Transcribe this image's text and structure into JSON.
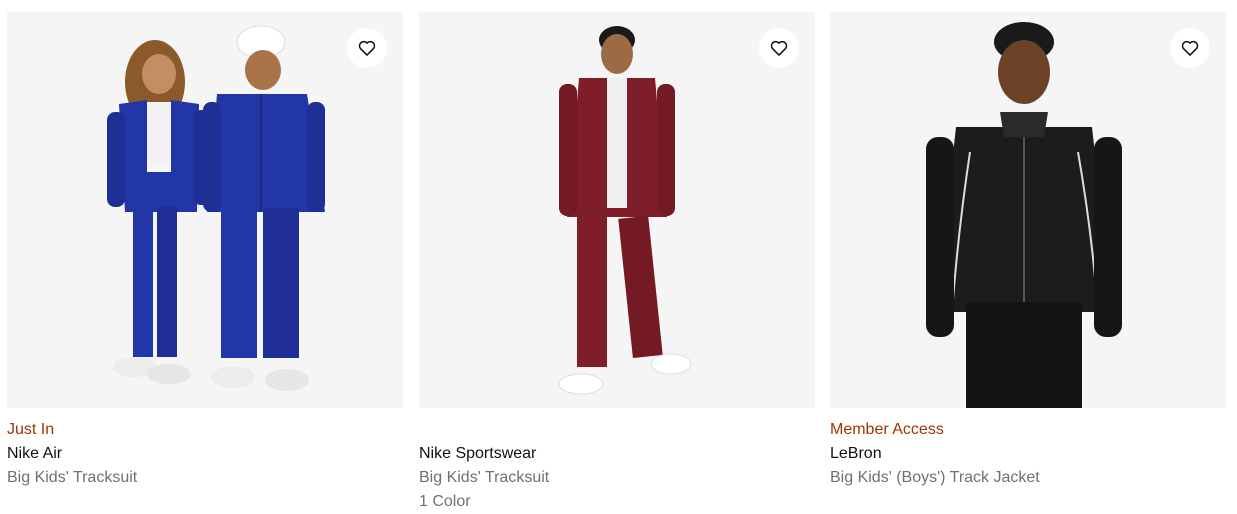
{
  "products": [
    {
      "badge": "Just In",
      "title": "Nike Air",
      "subtitle": "Big Kids' Tracksuit",
      "colors": ""
    },
    {
      "badge": "",
      "title": "Nike Sportswear",
      "subtitle": "Big Kids' Tracksuit",
      "colors": "1 Color"
    },
    {
      "badge": "Member Access",
      "title": "LeBron",
      "subtitle": "Big Kids' (Boys') Track Jacket",
      "colors": ""
    }
  ],
  "icons": {
    "favorite": "heart-icon"
  },
  "colors": {
    "badge": "#9e3500",
    "text_primary": "#111111",
    "text_secondary": "#707072",
    "image_bg": "#f5f5f5",
    "tracksuit_blue": "#2236a8",
    "tracksuit_red": "#7e1e2a",
    "jacket_black": "#1c1c1c"
  }
}
